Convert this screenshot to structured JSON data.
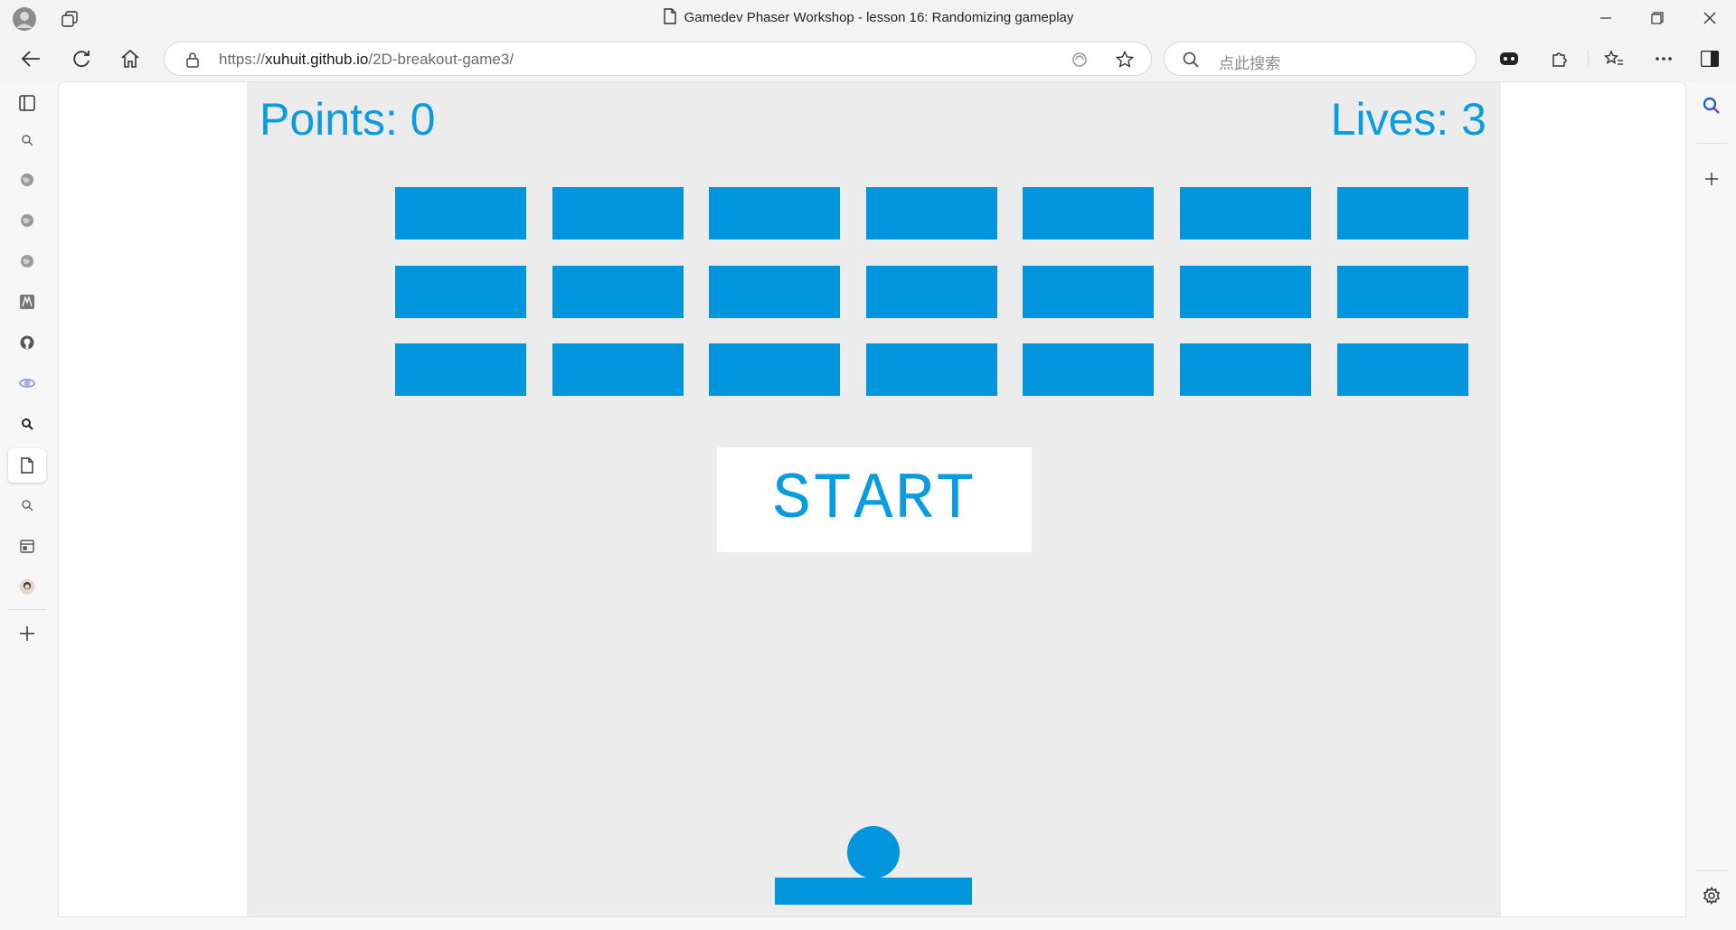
{
  "window": {
    "title": "Gamedev Phaser Workshop - lesson 16: Randomizing gameplay"
  },
  "address_bar": {
    "url_domain": "xuhuit.github.io",
    "url_prefix": "https://",
    "url_path": "/2D-breakout-game3/"
  },
  "search_bar": {
    "placeholder": "点此搜索"
  },
  "game": {
    "points_text": "Points: 0",
    "lives_text": "Lives: 3",
    "start_label": "START",
    "brick_rows": 3,
    "brick_columns": 7
  },
  "colors": {
    "accent": "#0095dd",
    "game_background": "#ececec"
  }
}
